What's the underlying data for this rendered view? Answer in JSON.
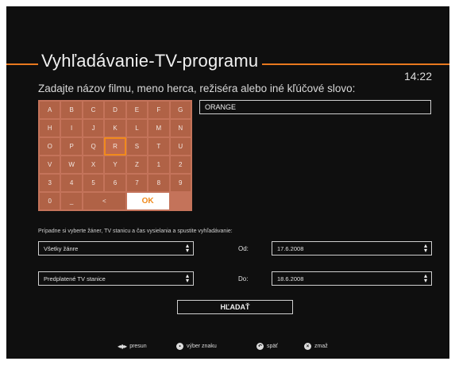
{
  "header": {
    "title": "Vyhľadávanie-TV-programu",
    "clock": "14:22"
  },
  "prompt": "Zadajte názov filmu, meno herca, režiséra alebo iné kľúčové slovo:",
  "keyboard": {
    "rows": [
      [
        "A",
        "B",
        "C",
        "D",
        "E",
        "F",
        "G"
      ],
      [
        "H",
        "I",
        "J",
        "K",
        "L",
        "M",
        "N"
      ],
      [
        "O",
        "P",
        "Q",
        "R",
        "S",
        "T",
        "U"
      ],
      [
        "V",
        "W",
        "X",
        "Y",
        "Z",
        "1",
        "2"
      ],
      [
        "3",
        "4",
        "5",
        "6",
        "7",
        "8",
        "9"
      ]
    ],
    "zero": "0",
    "space": "_",
    "back": "<",
    "ok": "OK",
    "selected": "R"
  },
  "search_field": {
    "value": "ORANGE"
  },
  "filters": {
    "hint": "Prípadne si vyberte žáner, TV stanicu a čas vysielania a spustite vyhľadávanie:",
    "genre": "Všetky žánre",
    "channel": "Predplatené TV stanice",
    "from_label": "Od:",
    "from_value": "17.6.2008",
    "to_label": "Do:",
    "to_value": "18.6.2008"
  },
  "search_button": "HĽADAŤ",
  "footer": {
    "move": "presun",
    "select": "výber znaku",
    "back": "späť",
    "delete": "zmaž",
    "icons": [
      "arrows-icon",
      "ok-icon",
      "back-icon",
      "delete-icon"
    ]
  },
  "colors": {
    "accent": "#e8781e",
    "keyboard": "#b06246",
    "background": "#0f0f0f"
  }
}
